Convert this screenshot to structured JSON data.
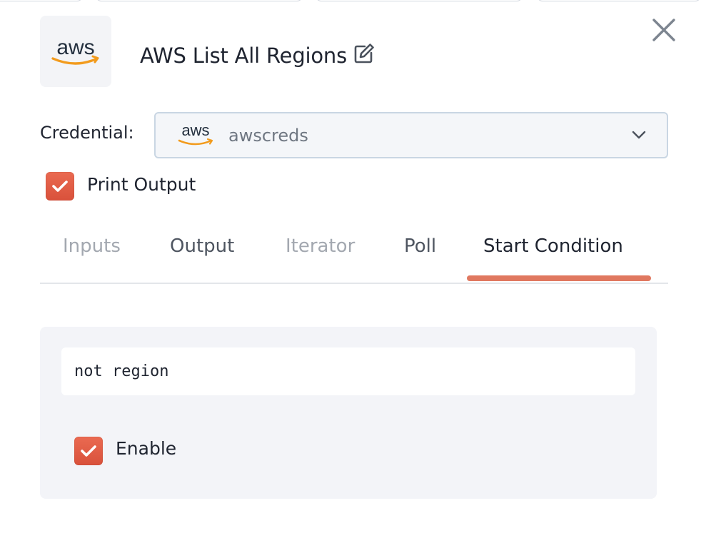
{
  "node": {
    "title": "AWS List All Regions",
    "logo_icon": "aws-logo"
  },
  "credential": {
    "label": "Credential:",
    "value": "awscreds",
    "icon": "aws-logo"
  },
  "print_output": {
    "label": "Print Output",
    "checked": true
  },
  "tabs": [
    {
      "label": "Inputs",
      "active": false
    },
    {
      "label": "Output",
      "active": false
    },
    {
      "label": "Iterator",
      "active": false
    },
    {
      "label": "Poll",
      "active": false
    },
    {
      "label": "Start Condition",
      "active": true
    }
  ],
  "start_condition": {
    "expression": "not region",
    "enable_label": "Enable",
    "enabled": true
  },
  "colors": {
    "accent": "#e07860",
    "checkbox": "#e05c45",
    "aws_orange": "#f29b1d",
    "aws_text": "#232f3e"
  }
}
